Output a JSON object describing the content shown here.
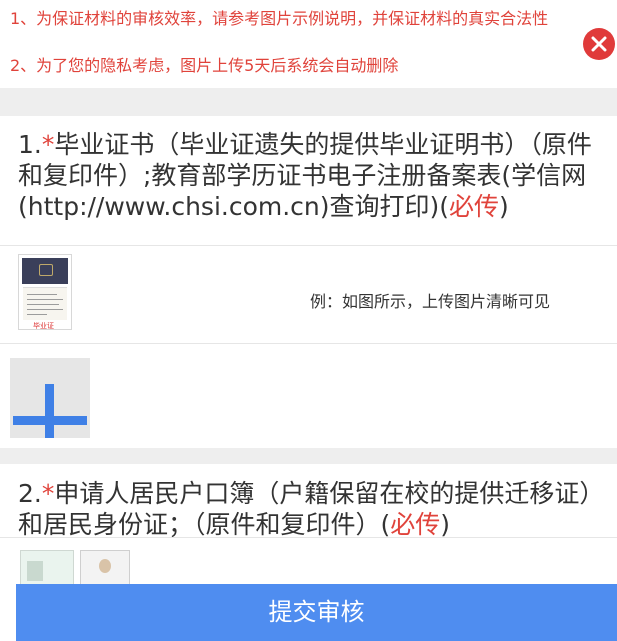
{
  "notice": {
    "line1": "1、为保证材料的审核效率，请参考图片示例说明，并保证材料的真实合法性",
    "line2": "2、为了您的隐私考虑，图片上传5天后系统会自动删除",
    "close_icon": "close-icon",
    "color": "#e0433b"
  },
  "section1": {
    "number": "1.",
    "required_mark": "*",
    "title": "毕业证书（毕业证遗失的提供毕业证明书）（原件和复印件）;教育部学历证书电子注册备案表(学信网(http://www.chsi.com.cn)查询打印)(",
    "required_label": "必传",
    "title_end": ")",
    "example_caption": "毕业证",
    "example_text": "例：如图所示，上传图片清晰可见",
    "upload_icon": "plus-icon"
  },
  "section2": {
    "number": "2.",
    "required_mark": "*",
    "title": "申请人居民户口簿（户籍保留在校的提供迁移证）和居民身份证；（原件和复印件）(",
    "required_label": "必传",
    "title_end": ")"
  },
  "submit": {
    "label": "提交审核",
    "color": "#4f8df0"
  }
}
